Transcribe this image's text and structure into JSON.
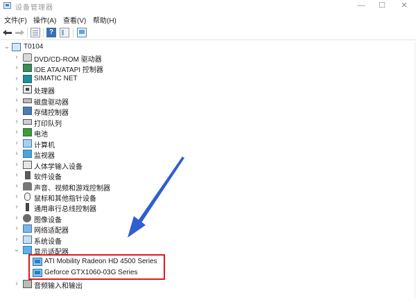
{
  "window": {
    "title": "设备管理器",
    "minimize": "—",
    "maximize": "☐",
    "close": "✕"
  },
  "menu": [
    "文件(F)",
    "操作(A)",
    "查看(V)",
    "帮助(H)"
  ],
  "toolbar": {
    "help_glyph": "?"
  },
  "tree": {
    "root": {
      "label": "T0104",
      "expander": "⌄",
      "icon": "computer-icon"
    },
    "categories": [
      {
        "label": "DVD/CD-ROM 驱动器",
        "icon": "dvd-drive-icon",
        "expander": "›"
      },
      {
        "label": "IDE ATA/ATAPI 控制器",
        "icon": "ide-controller-icon",
        "expander": "›"
      },
      {
        "label": "SIMATIC NET",
        "icon": "simatic-net-icon",
        "expander": "›"
      },
      {
        "label": "处理器",
        "icon": "processor-icon",
        "expander": "›"
      },
      {
        "label": "磁盘驱动器",
        "icon": "disk-drive-icon",
        "expander": "›"
      },
      {
        "label": "存储控制器",
        "icon": "storage-controller-icon",
        "expander": "›"
      },
      {
        "label": "打印队列",
        "icon": "printer-icon",
        "expander": "›"
      },
      {
        "label": "电池",
        "icon": "battery-icon",
        "expander": "›"
      },
      {
        "label": "计算机",
        "icon": "computer-icon",
        "expander": "›"
      },
      {
        "label": "监视器",
        "icon": "monitor-icon",
        "expander": "›"
      },
      {
        "label": "人体学输入设备",
        "icon": "hid-icon",
        "expander": "›"
      },
      {
        "label": "软件设备",
        "icon": "software-device-icon",
        "expander": "›"
      },
      {
        "label": "声音、视频和游戏控制器",
        "icon": "sound-icon",
        "expander": "›"
      },
      {
        "label": "鼠标和其他指针设备",
        "icon": "mouse-icon",
        "expander": "›"
      },
      {
        "label": "通用串行总线控制器",
        "icon": "usb-icon",
        "expander": "›"
      },
      {
        "label": "图像设备",
        "icon": "camera-icon",
        "expander": "›"
      },
      {
        "label": "网络适配器",
        "icon": "network-adapter-icon",
        "expander": "›"
      },
      {
        "label": "系统设备",
        "icon": "system-device-icon",
        "expander": "›"
      },
      {
        "label": "显示适配器",
        "icon": "display-adapter-icon",
        "expander": "⌄"
      }
    ],
    "display_adapters": [
      {
        "label": "ATI Mobility Radeon HD 4500 Series",
        "icon": "gpu-icon"
      },
      {
        "label": "Geforce GTX1060-03G Series",
        "icon": "gpu-icon"
      }
    ],
    "after": {
      "label": "音频输入和输出",
      "icon": "audio-icon",
      "expander": "›"
    }
  },
  "colors": {
    "highlight_border": "#e0181b",
    "arrow": "#2f5fd0"
  }
}
